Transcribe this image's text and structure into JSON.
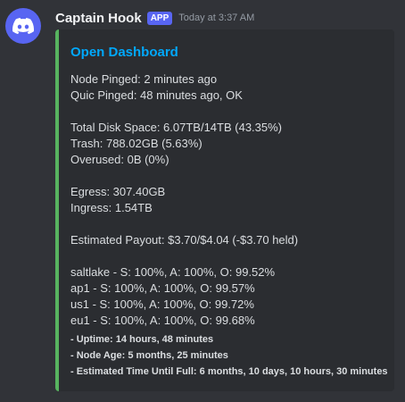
{
  "author": {
    "name": "Captain Hook",
    "badge": "APP",
    "timestamp": "Today at 3:37 AM",
    "avatar_icon": "discord-logo-icon",
    "avatar_color": "#5865f2"
  },
  "embed": {
    "accent_color": "#57b35f",
    "title": "Open Dashboard",
    "title_color": "#00a8fc",
    "ping": {
      "node": "Node Pinged: 2 minutes ago",
      "quic": "Quic Pinged: 48 minutes ago, OK"
    },
    "disk": {
      "total": "Total Disk Space: 6.07TB/14TB (43.35%)",
      "trash": "Trash: 788.02GB (5.63%)",
      "overused": "Overused: 0B (0%)"
    },
    "bandwidth": {
      "egress": "Egress: 307.40GB",
      "ingress": "Ingress: 1.54TB"
    },
    "payout": "Estimated Payout: $3.70/$4.04 (-$3.70 held)",
    "satellites": [
      "saltlake - S: 100%, A: 100%, O: 99.52%",
      "ap1 - S: 100%, A: 100%, O: 99.57%",
      "us1 - S: 100%, A: 100%, O: 99.72%",
      "eu1 - S: 100%, A: 100%, O: 99.68%"
    ],
    "footer": [
      "- Uptime: 14 hours, 48 minutes",
      "- Node Age: 5 months, 25 minutes",
      "- Estimated Time Until Full: 6 months, 10 days, 10 hours, 30 minutes"
    ]
  }
}
